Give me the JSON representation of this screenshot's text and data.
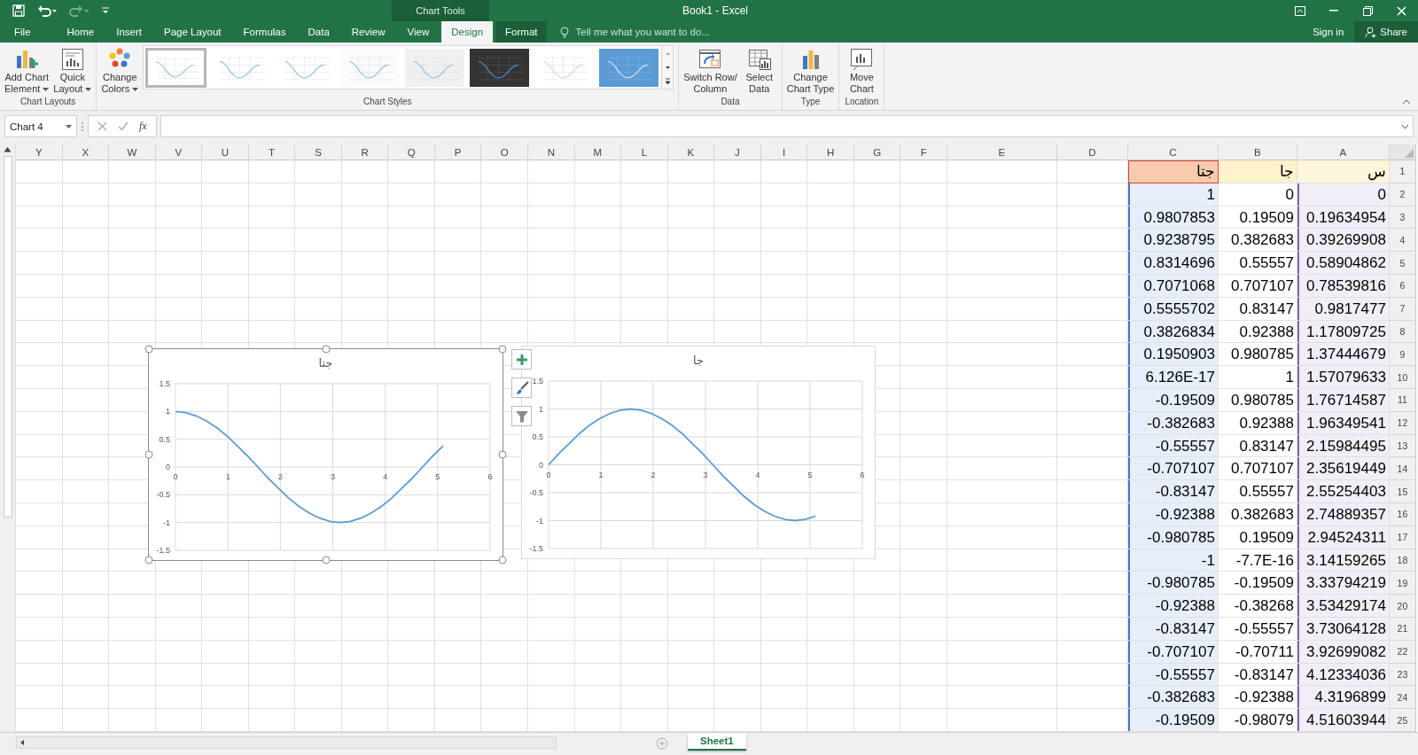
{
  "window": {
    "title": "Book1 - Excel",
    "context_title": "Chart Tools"
  },
  "quick_access": [
    {
      "kind": "save",
      "disabled": false
    },
    {
      "kind": "undo",
      "disabled": false
    },
    {
      "kind": "redo",
      "disabled": true
    },
    {
      "kind": "customize",
      "disabled": false
    }
  ],
  "tabs": [
    {
      "label": "File",
      "selected": false,
      "contextual": false
    },
    {
      "label": "Home",
      "selected": false,
      "contextual": false
    },
    {
      "label": "Insert",
      "selected": false,
      "contextual": false
    },
    {
      "label": "Page Layout",
      "selected": false,
      "contextual": false
    },
    {
      "label": "Formulas",
      "selected": false,
      "contextual": false
    },
    {
      "label": "Data",
      "selected": false,
      "contextual": false
    },
    {
      "label": "Review",
      "selected": false,
      "contextual": false
    },
    {
      "label": "View",
      "selected": false,
      "contextual": false
    },
    {
      "label": "Design",
      "selected": true,
      "contextual": true
    },
    {
      "label": "Format",
      "selected": false,
      "contextual": true
    }
  ],
  "tell_me": {
    "placeholder": "Tell me what you want to do..."
  },
  "account": {
    "sign_in": "Sign in",
    "share": "Share"
  },
  "ribbon": {
    "groups": [
      {
        "label": "Chart Layouts",
        "buttons": [
          {
            "kind": "add-element",
            "lines": [
              "Add Chart",
              "Element"
            ],
            "dropdown": true
          },
          {
            "kind": "quick-layout",
            "lines": [
              "Quick",
              "Layout"
            ],
            "dropdown": true
          }
        ]
      },
      {
        "label": "Chart Styles",
        "buttons": [
          {
            "kind": "colors",
            "lines": [
              "Change",
              "Colors"
            ],
            "dropdown": true
          }
        ],
        "gallery": [
          {
            "kind": "light",
            "selected": true
          },
          {
            "kind": "light",
            "selected": false
          },
          {
            "kind": "light",
            "selected": false
          },
          {
            "kind": "grid",
            "selected": false
          },
          {
            "kind": "shaded",
            "selected": false
          },
          {
            "kind": "dark",
            "selected": false
          },
          {
            "kind": "faint",
            "selected": false
          },
          {
            "kind": "blue",
            "selected": false
          }
        ]
      },
      {
        "label": "Data",
        "buttons": [
          {
            "kind": "switch",
            "lines": [
              "Switch Row/",
              "Column"
            ]
          },
          {
            "kind": "select-data",
            "lines": [
              "Select",
              "Data"
            ]
          }
        ]
      },
      {
        "label": "Type",
        "buttons": [
          {
            "kind": "chart-type",
            "lines": [
              "Change",
              "Chart Type"
            ]
          }
        ]
      },
      {
        "label": "Location",
        "buttons": [
          {
            "kind": "move",
            "lines": [
              "Move",
              "Chart"
            ]
          }
        ]
      }
    ]
  },
  "formula_bar": {
    "name_box": "Chart 4",
    "function_label": "fx"
  },
  "sheet": {
    "columns": [
      "Y",
      "X",
      "W",
      "V",
      "U",
      "T",
      "S",
      "R",
      "Q",
      "P",
      "O",
      "N",
      "M",
      "L",
      "K",
      "J",
      "I",
      "H",
      "G",
      "F",
      "E",
      "D",
      "C",
      "B",
      "A"
    ],
    "rows": [
      {
        "header": "1",
        "cells": [
          null,
          null,
          null,
          null,
          null,
          null,
          null,
          null,
          null,
          null,
          null,
          null,
          null,
          null,
          null,
          null,
          null,
          null,
          null,
          null,
          null,
          null,
          "جتا",
          "جا",
          "س"
        ]
      },
      {
        "header": "2",
        "cells": [
          null,
          null,
          null,
          null,
          null,
          null,
          null,
          null,
          null,
          null,
          null,
          null,
          null,
          null,
          null,
          null,
          null,
          null,
          null,
          null,
          null,
          null,
          "1",
          "0",
          "0"
        ]
      },
      {
        "header": "3",
        "cells": [
          null,
          null,
          null,
          null,
          null,
          null,
          null,
          null,
          null,
          null,
          null,
          null,
          null,
          null,
          null,
          null,
          null,
          null,
          null,
          null,
          null,
          null,
          "0.9807853",
          "0.19509",
          "0.19634954"
        ]
      },
      {
        "header": "4",
        "cells": [
          null,
          null,
          null,
          null,
          null,
          null,
          null,
          null,
          null,
          null,
          null,
          null,
          null,
          null,
          null,
          null,
          null,
          null,
          null,
          null,
          null,
          null,
          "0.9238795",
          "0.382683",
          "0.39269908"
        ]
      },
      {
        "header": "5",
        "cells": [
          null,
          null,
          null,
          null,
          null,
          null,
          null,
          null,
          null,
          null,
          null,
          null,
          null,
          null,
          null,
          null,
          null,
          null,
          null,
          null,
          null,
          null,
          "0.8314696",
          "0.55557",
          "0.58904862"
        ]
      },
      {
        "header": "6",
        "cells": [
          null,
          null,
          null,
          null,
          null,
          null,
          null,
          null,
          null,
          null,
          null,
          null,
          null,
          null,
          null,
          null,
          null,
          null,
          null,
          null,
          null,
          null,
          "0.7071068",
          "0.707107",
          "0.78539816"
        ]
      },
      {
        "header": "7",
        "cells": [
          null,
          null,
          null,
          null,
          null,
          null,
          null,
          null,
          null,
          null,
          null,
          null,
          null,
          null,
          null,
          null,
          null,
          null,
          null,
          null,
          null,
          null,
          "0.5555702",
          "0.83147",
          "0.9817477"
        ]
      },
      {
        "header": "8",
        "cells": [
          null,
          null,
          null,
          null,
          null,
          null,
          null,
          null,
          null,
          null,
          null,
          null,
          null,
          null,
          null,
          null,
          null,
          null,
          null,
          null,
          null,
          null,
          "0.3826834",
          "0.92388",
          "1.17809725"
        ]
      },
      {
        "header": "9",
        "cells": [
          null,
          null,
          null,
          null,
          null,
          null,
          null,
          null,
          null,
          null,
          null,
          null,
          null,
          null,
          null,
          null,
          null,
          null,
          null,
          null,
          null,
          null,
          "0.1950903",
          "0.980785",
          "1.37444679"
        ]
      },
      {
        "header": "10",
        "cells": [
          null,
          null,
          null,
          null,
          null,
          null,
          null,
          null,
          null,
          null,
          null,
          null,
          null,
          null,
          null,
          null,
          null,
          null,
          null,
          null,
          null,
          null,
          "6.126E-17",
          "1",
          "1.57079633"
        ]
      },
      {
        "header": "11",
        "cells": [
          null,
          null,
          null,
          null,
          null,
          null,
          null,
          null,
          null,
          null,
          null,
          null,
          null,
          null,
          null,
          null,
          null,
          null,
          null,
          null,
          null,
          null,
          "-0.19509",
          "0.980785",
          "1.76714587"
        ]
      },
      {
        "header": "12",
        "cells": [
          null,
          null,
          null,
          null,
          null,
          null,
          null,
          null,
          null,
          null,
          null,
          null,
          null,
          null,
          null,
          null,
          null,
          null,
          null,
          null,
          null,
          null,
          "-0.382683",
          "0.92388",
          "1.96349541"
        ]
      },
      {
        "header": "13",
        "cells": [
          null,
          null,
          null,
          null,
          null,
          null,
          null,
          null,
          null,
          null,
          null,
          null,
          null,
          null,
          null,
          null,
          null,
          null,
          null,
          null,
          null,
          null,
          "-0.55557",
          "0.83147",
          "2.15984495"
        ]
      },
      {
        "header": "14",
        "cells": [
          null,
          null,
          null,
          null,
          null,
          null,
          null,
          null,
          null,
          null,
          null,
          null,
          null,
          null,
          null,
          null,
          null,
          null,
          null,
          null,
          null,
          null,
          "-0.707107",
          "0.707107",
          "2.35619449"
        ]
      },
      {
        "header": "15",
        "cells": [
          null,
          null,
          null,
          null,
          null,
          null,
          null,
          null,
          null,
          null,
          null,
          null,
          null,
          null,
          null,
          null,
          null,
          null,
          null,
          null,
          null,
          null,
          "-0.83147",
          "0.55557",
          "2.55254403"
        ]
      },
      {
        "header": "16",
        "cells": [
          null,
          null,
          null,
          null,
          null,
          null,
          null,
          null,
          null,
          null,
          null,
          null,
          null,
          null,
          null,
          null,
          null,
          null,
          null,
          null,
          null,
          null,
          "-0.92388",
          "0.382683",
          "2.74889357"
        ]
      },
      {
        "header": "17",
        "cells": [
          null,
          null,
          null,
          null,
          null,
          null,
          null,
          null,
          null,
          null,
          null,
          null,
          null,
          null,
          null,
          null,
          null,
          null,
          null,
          null,
          null,
          null,
          "-0.980785",
          "0.19509",
          "2.94524311"
        ]
      },
      {
        "header": "18",
        "cells": [
          null,
          null,
          null,
          null,
          null,
          null,
          null,
          null,
          null,
          null,
          null,
          null,
          null,
          null,
          null,
          null,
          null,
          null,
          null,
          null,
          null,
          null,
          "-1",
          "-7.7E-16",
          "3.14159265"
        ]
      },
      {
        "header": "19",
        "cells": [
          null,
          null,
          null,
          null,
          null,
          null,
          null,
          null,
          null,
          null,
          null,
          null,
          null,
          null,
          null,
          null,
          null,
          null,
          null,
          null,
          null,
          null,
          "-0.980785",
          "-0.19509",
          "3.33794219"
        ]
      },
      {
        "header": "20",
        "cells": [
          null,
          null,
          null,
          null,
          null,
          null,
          null,
          null,
          null,
          null,
          null,
          null,
          null,
          null,
          null,
          null,
          null,
          null,
          null,
          null,
          null,
          null,
          "-0.92388",
          "-0.38268",
          "3.53429174"
        ]
      },
      {
        "header": "21",
        "cells": [
          null,
          null,
          null,
          null,
          null,
          null,
          null,
          null,
          null,
          null,
          null,
          null,
          null,
          null,
          null,
          null,
          null,
          null,
          null,
          null,
          null,
          null,
          "-0.83147",
          "-0.55557",
          "3.73064128"
        ]
      },
      {
        "header": "22",
        "cells": [
          null,
          null,
          null,
          null,
          null,
          null,
          null,
          null,
          null,
          null,
          null,
          null,
          null,
          null,
          null,
          null,
          null,
          null,
          null,
          null,
          null,
          null,
          "-0.707107",
          "-0.70711",
          "3.92699082"
        ]
      },
      {
        "header": "23",
        "cells": [
          null,
          null,
          null,
          null,
          null,
          null,
          null,
          null,
          null,
          null,
          null,
          null,
          null,
          null,
          null,
          null,
          null,
          null,
          null,
          null,
          null,
          null,
          "-0.55557",
          "-0.83147",
          "4.12334036"
        ]
      },
      {
        "header": "24",
        "cells": [
          null,
          null,
          null,
          null,
          null,
          null,
          null,
          null,
          null,
          null,
          null,
          null,
          null,
          null,
          null,
          null,
          null,
          null,
          null,
          null,
          null,
          null,
          "-0.382683",
          "-0.92388",
          "4.3196899"
        ]
      },
      {
        "header": "25",
        "cells": [
          null,
          null,
          null,
          null,
          null,
          null,
          null,
          null,
          null,
          null,
          null,
          null,
          null,
          null,
          null,
          null,
          null,
          null,
          null,
          null,
          null,
          null,
          "-0.19509",
          "-0.98079",
          "4.51603944"
        ]
      }
    ]
  },
  "charts": [
    {
      "selected": false,
      "chart_data": {
        "type": "line",
        "title": "جا",
        "grid": true,
        "x": [
          0,
          0.196,
          0.393,
          0.589,
          0.785,
          0.982,
          1.178,
          1.374,
          1.571,
          1.767,
          1.963,
          2.16,
          2.356,
          2.553,
          2.749,
          2.945,
          3.142,
          3.338,
          3.534,
          3.731,
          3.927,
          4.123,
          4.32,
          4.516,
          4.712,
          4.909,
          5.105
        ],
        "series": [
          {
            "color": "#5b9bd5",
            "values": [
              0,
              0.2,
              0.38,
              0.56,
              0.71,
              0.83,
              0.92,
              0.98,
              1,
              0.98,
              0.92,
              0.83,
              0.71,
              0.56,
              0.38,
              0.2,
              0,
              -0.2,
              -0.38,
              -0.56,
              -0.71,
              -0.83,
              -0.92,
              -0.98,
              -1,
              -0.98,
              -0.92
            ]
          }
        ],
        "xlim": [
          0,
          6
        ],
        "ylim": [
          -1.5,
          1.5
        ],
        "xticks": [
          0,
          1,
          2,
          3,
          4,
          5,
          6
        ],
        "yticks": [
          -1.5,
          -1,
          -0.5,
          0,
          0.5,
          1,
          1.5
        ]
      }
    },
    {
      "selected": true,
      "chart_data": {
        "type": "line",
        "title": "جتا",
        "grid": true,
        "x": [
          0,
          0.196,
          0.393,
          0.589,
          0.785,
          0.982,
          1.178,
          1.374,
          1.571,
          1.767,
          1.963,
          2.16,
          2.356,
          2.553,
          2.749,
          2.945,
          3.142,
          3.338,
          3.534,
          3.731,
          3.927,
          4.123,
          4.32,
          4.516,
          4.712,
          4.909,
          5.105
        ],
        "series": [
          {
            "color": "#5b9bd5",
            "values": [
              1,
              0.98,
              0.92,
              0.83,
              0.71,
              0.56,
              0.38,
              0.2,
              0,
              -0.2,
              -0.38,
              -0.56,
              -0.71,
              -0.83,
              -0.92,
              -0.98,
              -1,
              -0.98,
              -0.92,
              -0.83,
              -0.71,
              -0.56,
              -0.38,
              -0.2,
              0,
              0.2,
              0.38
            ]
          }
        ],
        "xlim": [
          0,
          6
        ],
        "ylim": [
          -1.5,
          1.5
        ],
        "xticks": [
          0,
          1,
          2,
          3,
          4,
          5,
          6
        ],
        "yticks": [
          -1.5,
          -1,
          -0.5,
          0,
          0.5,
          1,
          1.5
        ]
      }
    }
  ],
  "sheet_tabs": [
    {
      "label": "Sheet1",
      "selected": true
    }
  ]
}
